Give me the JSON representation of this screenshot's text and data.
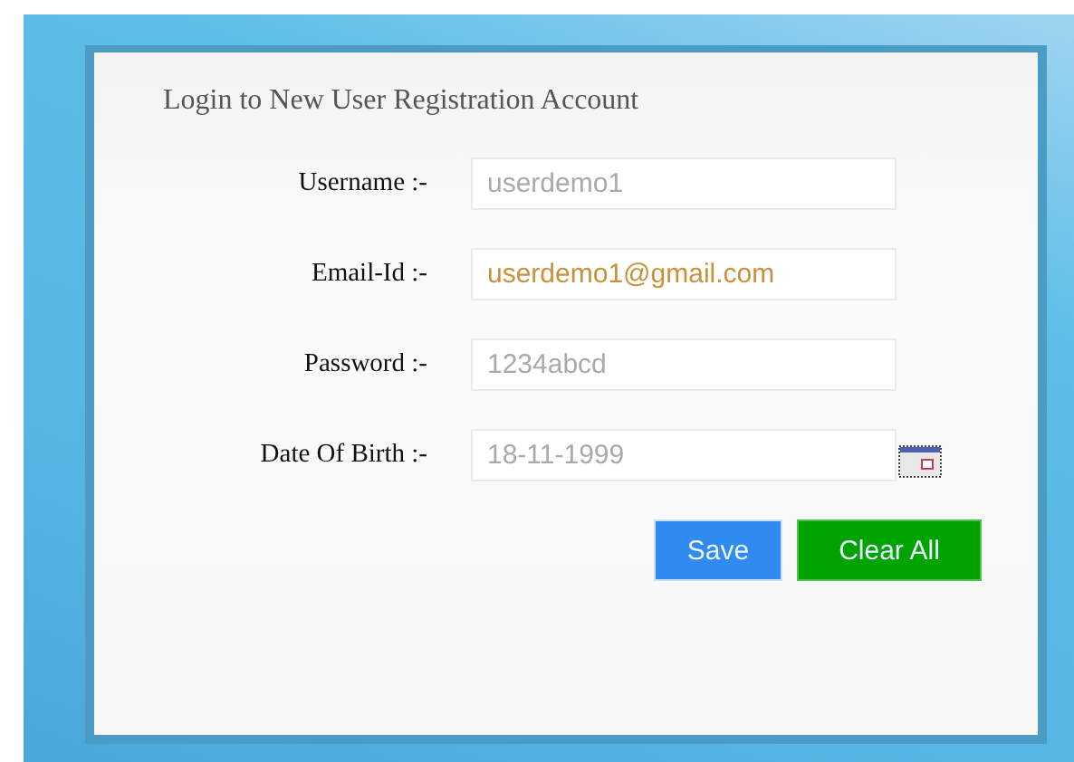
{
  "form": {
    "title": "Login to New User Registration Account",
    "fields": [
      {
        "label": "Username :-",
        "placeholder": "userdemo1",
        "kind": "text"
      },
      {
        "label": "Email-Id :-",
        "value": "userdemo1@gmail.com",
        "kind": "text"
      },
      {
        "label": "Password :-",
        "placeholder": "1234abcd",
        "kind": "text"
      },
      {
        "label": "Date Of Birth :-",
        "placeholder": "18-11-1999",
        "kind": "date"
      }
    ],
    "buttons": [
      {
        "label": "Save",
        "kind": "primary"
      },
      {
        "label": "Clear All",
        "kind": "success"
      }
    ]
  }
}
